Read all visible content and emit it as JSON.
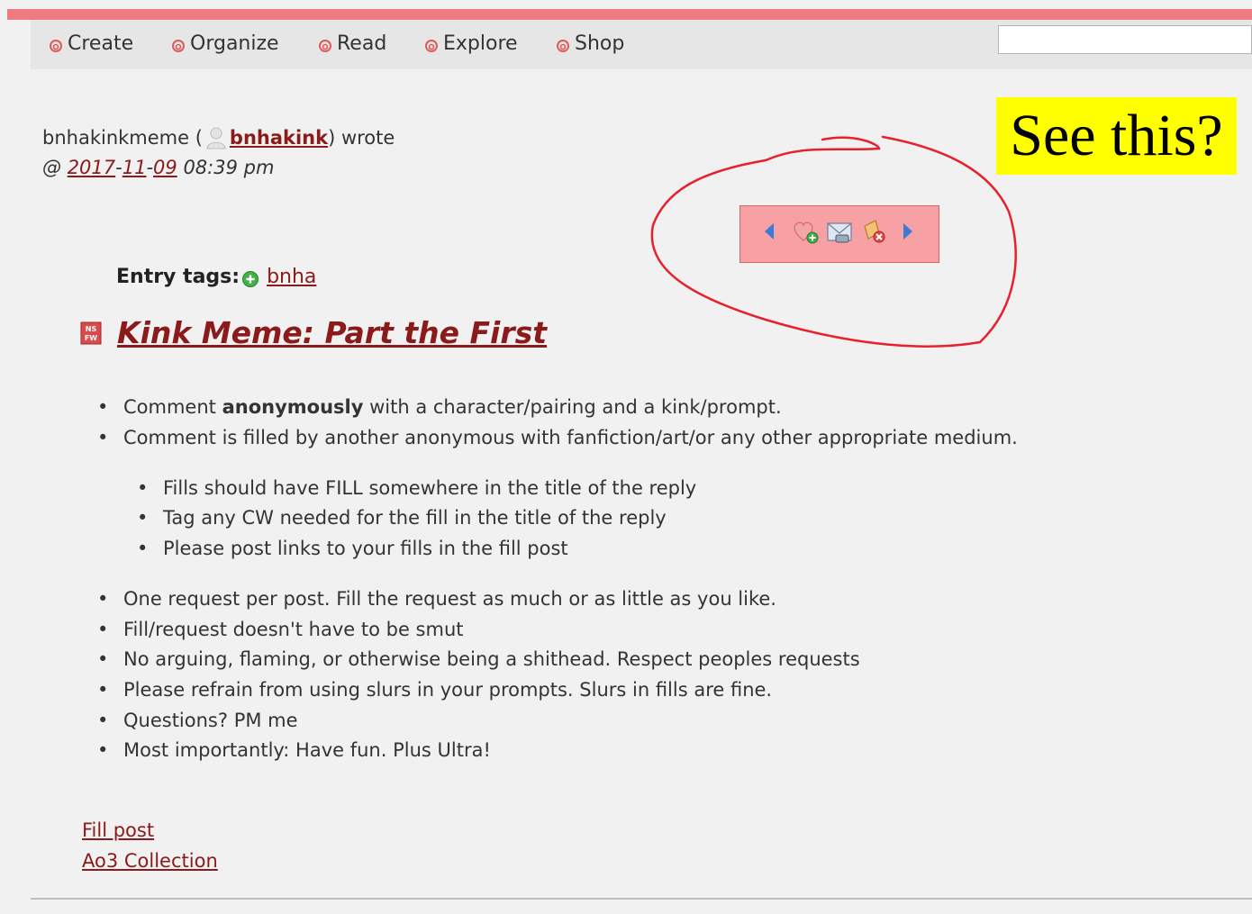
{
  "nav": {
    "items": [
      {
        "label": "Create"
      },
      {
        "label": "Organize"
      },
      {
        "label": "Read"
      },
      {
        "label": "Explore"
      },
      {
        "label": "Shop"
      }
    ],
    "search_value": ""
  },
  "byline": {
    "community": "bnhakinkmeme (",
    "username": "bnhakink",
    "suffix": ") wrote",
    "at": "@ ",
    "year": "2017",
    "month": "11",
    "day": "09",
    "time": " 08:39 pm"
  },
  "callout": {
    "text": "See this?"
  },
  "entry_nav_icons": [
    "previous-entry-icon",
    "add-memory-icon",
    "share-entry-icon",
    "track-entry-icon",
    "next-entry-icon"
  ],
  "entry_tags": {
    "label": "Entry tags:",
    "tags": [
      "bnha"
    ]
  },
  "post": {
    "nsfw_icon": "nsfw-icon",
    "title": "Kink Meme: Part the First"
  },
  "rules": {
    "first_prefix": "Comment ",
    "first_bold": "anonymously",
    "first_suffix": " with a character/pairing and a kink/prompt.",
    "second": "Comment is filled by another anonymous with fanfiction/art/or any other appropriate medium.",
    "sub": [
      "Fills should have FILL somewhere in the title of the reply",
      "Tag any CW needed for the fill in the title of the reply",
      "Please post links to your fills in the fill post"
    ],
    "rest": [
      "One request per post. Fill the request as much or as little as you like.",
      "Fill/request doesn't have to be smut",
      "No arguing, flaming, or otherwise being a shithead. Respect peoples requests",
      "Please refrain from using slurs in your prompts. Slurs in fills are fine.",
      "Questions? PM me",
      "Most importantly: Have fun. Plus Ultra!"
    ]
  },
  "links": {
    "fill_post": "Fill post",
    "ao3": "Ao3 Collection"
  },
  "colors": {
    "accent": "#ef7b80",
    "link": "#8b1a1a",
    "highlight": "#ffff00",
    "annotation": "#e8202c"
  }
}
